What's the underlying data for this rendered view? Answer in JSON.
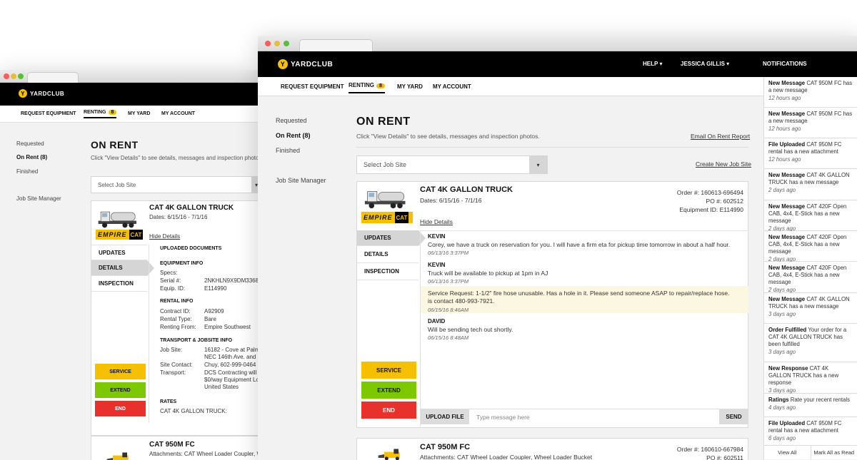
{
  "colors": {
    "accent": "#f5c000",
    "service": "#f5c000",
    "extend": "#7dc800",
    "end": "#e8312b",
    "topbar": "#000000"
  },
  "brand": {
    "name": "YARDCLUB",
    "mark": "Y"
  },
  "header": {
    "help": "HELP",
    "user": "JESSICA GILLIS",
    "notifications": "NOTIFICATIONS"
  },
  "nav": {
    "request": "REQUEST EQUIPMENT",
    "renting": "RENTING",
    "renting_count": "8",
    "my_yard": "MY YARD",
    "my_account": "MY ACCOUNT"
  },
  "sidebar": {
    "requested": "Requested",
    "on_rent": "On Rent (8)",
    "finished": "Finished",
    "job_site_manager": "Job Site Manager"
  },
  "page": {
    "title": "ON RENT",
    "subtitle": "Click \"View Details\" to see details, messages and inspection photos.",
    "email_link": "Email On Rent Report",
    "select_placeholder": "Select Job Site",
    "create_link": "Create New Job Site"
  },
  "rental1": {
    "title": "CAT 4K GALLON TRUCK",
    "dates": "Dates: 6/15/16 - 7/1/16",
    "order": "Order #: 160613-696494",
    "po": "PO #: 602512",
    "equip": "Equipment ID: E114990",
    "hide": "Hide Details",
    "vendor_logo": "EMPIRE",
    "vendor_sub": "CAT",
    "tabs": {
      "updates": "UPDATES",
      "details": "DETAILS",
      "inspection": "INSPECTION"
    },
    "actions": {
      "service": "SERVICE",
      "extend": "EXTEND",
      "end": "END"
    },
    "messages": [
      {
        "name": "KEVIN",
        "body": "Corey, we have a truck on reservation for you. I will have a firm eta for pickup time tomorrow in about a half hour.",
        "time": "06/13/16 3:37PM"
      },
      {
        "name": "KEVIN",
        "body": "Truck will be available to pickup at 1pm in AJ",
        "time": "06/13/16 3:37PM"
      },
      {
        "name": "",
        "body": "Service Request: 1-1/2\" fire hose unusable. Has a hole in it. Please send someone ASAP to repair/replace hose.",
        "body2": "is contact 480-993-7921.",
        "time": "06/15/16 8:46AM"
      },
      {
        "name": "DAVID",
        "body": "Will be sending tech out shortly.",
        "time": "06/15/16 8:48AM"
      }
    ],
    "compose": {
      "upload": "UPLOAD FILE",
      "placeholder": "Type message here",
      "send": "SEND"
    }
  },
  "rental2": {
    "title": "CAT 950M FC",
    "attachments": "Attachments: CAT Wheel Loader Coupler, Wheel Loader Bucket",
    "order": "Order #: 160610-667984",
    "po": "PO #: 602511"
  },
  "back": {
    "attachments_trunc": "Attachments: CAT Wheel Loader Coupler, W",
    "sections": {
      "uploaded": "UPLOADED DOCUMENTS",
      "equipment": "EQUIPMENT INFO",
      "rental": "RENTAL INFO",
      "transport": "TRANSPORT & JOBSITE INFO",
      "rates": "RATES"
    },
    "equipment": {
      "specs": "Specs:",
      "serial_label": "Serial #:",
      "serial": "2NKHLN9X9DM33680",
      "equip_label": "Equip. ID:",
      "equip": "E114990"
    },
    "rental": {
      "contract_label": "Contract ID:",
      "contract": "A92909",
      "type_label": "Rental Type:",
      "type": "Bare",
      "from_label": "Renting From:",
      "from": "Empire Southwest"
    },
    "transport": {
      "job_label": "Job Site:",
      "job1": "16182 - Cove at Palm",
      "job2": "NEC 146th Ave. and C",
      "contact_label": "Site Contact:",
      "contact": "Chuy, 602-999-0464",
      "transport_label": "Transport:",
      "t1": "DCS Contracting will T",
      "t2": "$0/way Equipment Lo",
      "t3": "United States"
    },
    "rates": {
      "item": "CAT 4K GALLON TRUCK:"
    }
  },
  "notifications": [
    {
      "type": "New Message",
      "text": "CAT 950M FC has a new message",
      "time": "12 hours ago"
    },
    {
      "type": "New Message",
      "text": "CAT 950M FC has a new message",
      "time": "12 hours ago"
    },
    {
      "type": "File Uploaded",
      "text": "CAT 950M FC rental has a new attachment",
      "time": "12 hours ago"
    },
    {
      "type": "New Message",
      "text": "CAT 4K GALLON TRUCK has a new message",
      "time": "2 days ago"
    },
    {
      "type": "New Message",
      "text": "CAT 420F Open CAB, 4x4, E-Stick has a new message",
      "time": "2 days ago"
    },
    {
      "type": "New Message",
      "text": "CAT 420F Open CAB, 4x4, E-Stick has a new message",
      "time": "2 days ago"
    },
    {
      "type": "New Message",
      "text": "CAT 420F Open CAB, 4x4, E-Stick has a new message",
      "time": "2 days ago"
    },
    {
      "type": "New Message",
      "text": "CAT 4K GALLON TRUCK has a new message",
      "time": "3 days ago"
    },
    {
      "type": "Order Fulfilled",
      "text": "Your order for a CAT 4K GALLON TRUCK has been fulfilled",
      "time": "3 days ago"
    },
    {
      "type": "New Response",
      "text": "CAT 4K GALLON TRUCK has a new response",
      "time": "3 days ago"
    },
    {
      "type": "Ratings",
      "text": "Rate your recent rentals",
      "time": "4 days ago"
    },
    {
      "type": "File Uploaded",
      "text": "CAT 950M FC rental has a new attachment",
      "time": "6 days ago"
    }
  ],
  "notif_footer": {
    "view_all": "View All",
    "mark_all": "Mark All as Read"
  }
}
